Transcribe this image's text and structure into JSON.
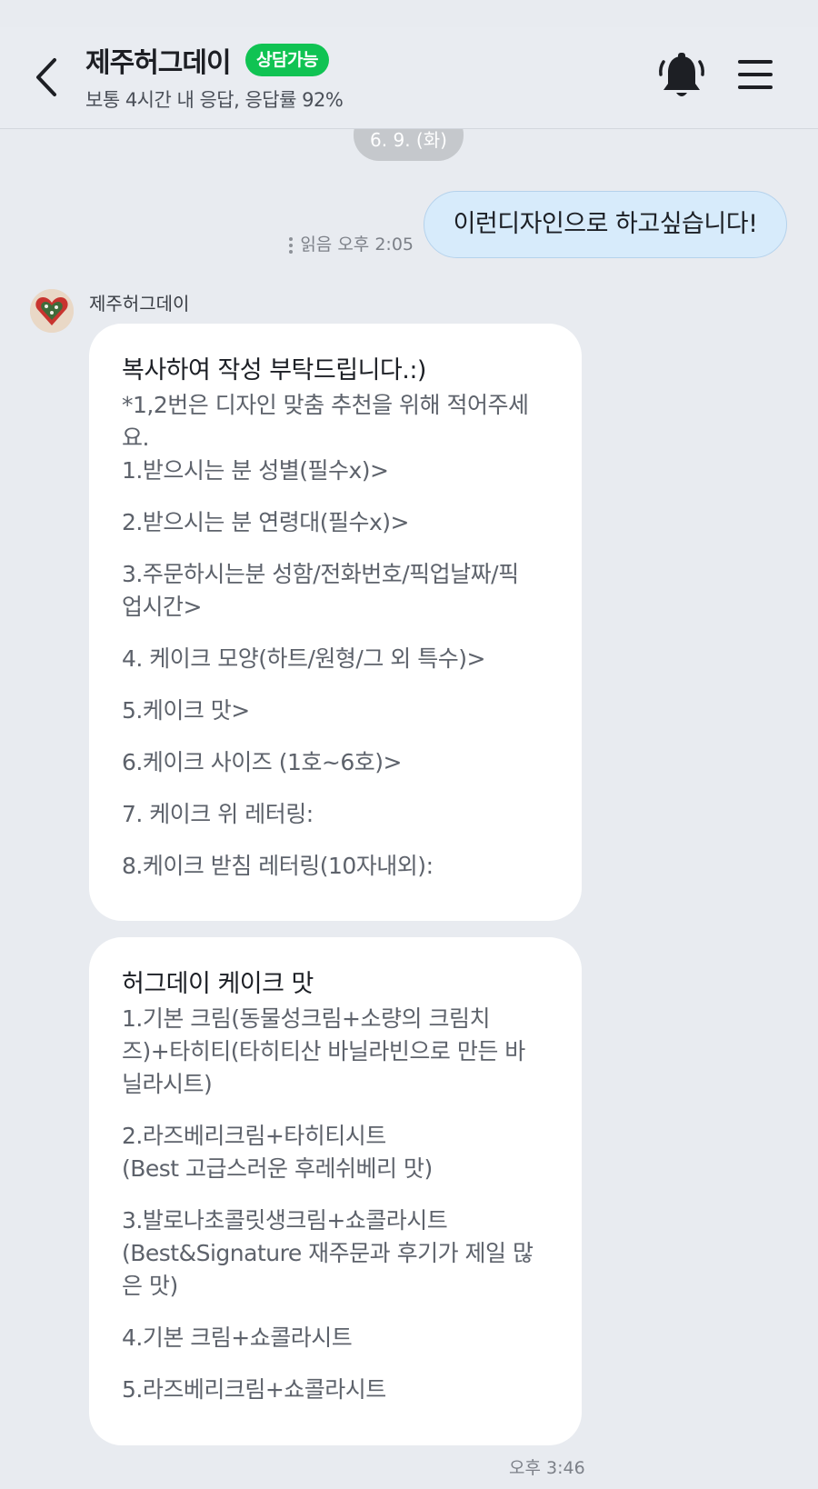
{
  "header": {
    "back_icon": "chevron-left-icon",
    "title": "제주허그데이",
    "status_badge": "상담가능",
    "subtitle": "보통 4시간 내 응답, 응답률 92%",
    "bell_icon": "bell-icon",
    "menu_icon": "hamburger-menu-icon",
    "badge_color": "#10c353"
  },
  "chat": {
    "date_chip": "6. 9. (화)",
    "outgoing": {
      "text": "이런디자인으로 하고싶습니다!",
      "read_status": "읽음",
      "time": "오후 2:05"
    },
    "incoming": {
      "sender": "제주허그데이",
      "time": "오후 3:46",
      "message1": {
        "title": "복사하여 작성 부탁드립니다.:)",
        "note": "*1,2번은 디자인 맞춤 추천을 위해 적어주세\n요.",
        "items": [
          "1.받으시는 분 성별(필수x)>",
          "2.받으시는 분 연령대(필수x)>",
          "3.주문하시는분 성함/전화번호/픽업날짜/픽\n업시간>",
          "4. 케이크 모양(하트/원형/그 외 특수)>",
          "5.케이크 맛>",
          "6.케이크 사이즈 (1호~6호)>",
          "7. 케이크 위 레터링:",
          "8.케이크 받침 레터링(10자내외):"
        ]
      },
      "message2": {
        "title": "허그데이 케이크 맛",
        "items": [
          "1.기본 크림(동물성크림+소량의 크림치\n즈)+타히티(타히티산 바닐라빈으로 만든 바\n닐라시트)",
          "2.라즈베리크림+타히티시트\n(Best 고급스러운 후레쉬베리 맛)",
          "3.발로나초콜릿생크림+쇼콜라시트\n(Best&Signature 재주문과 후기가 제일 많\n은 맛)",
          "4.기본 크림+쇼콜라시트",
          "5.라즈베리크림+쇼콜라시트"
        ]
      }
    }
  }
}
